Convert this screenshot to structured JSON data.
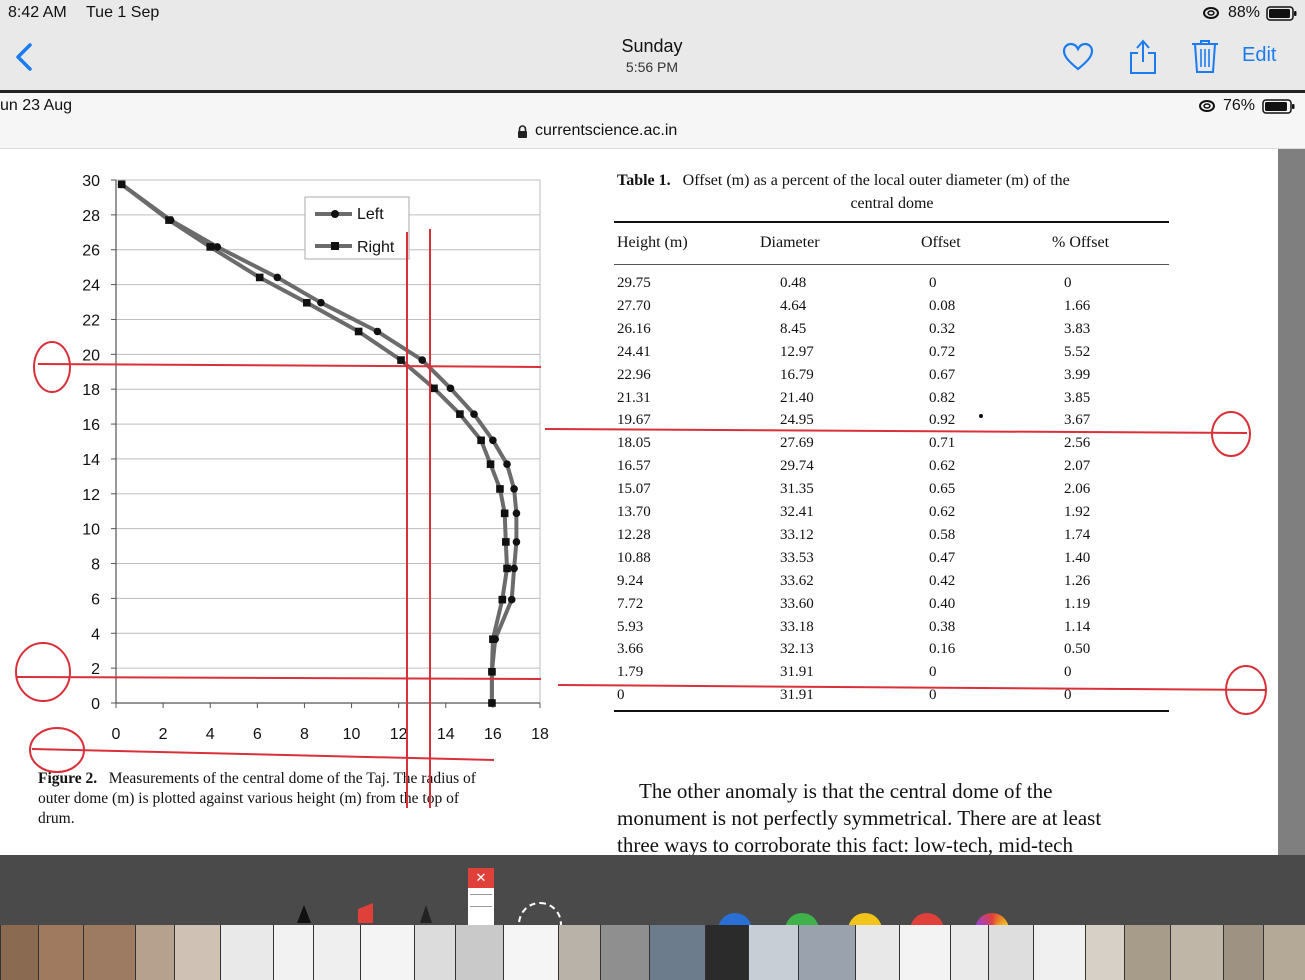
{
  "status": {
    "time": "8:42 AM",
    "date": "Tue 1 Sep",
    "battery": "88%"
  },
  "nav": {
    "title": "Sunday",
    "subtitle": "5:56 PM",
    "edit": "Edit"
  },
  "inner": {
    "date": "un 23 Aug",
    "battery": "76%",
    "url": "currentscience.ac.in"
  },
  "chart_data": {
    "type": "line",
    "xlim": [
      0,
      18
    ],
    "ylim": [
      0,
      30
    ],
    "x_ticks": [
      0,
      2,
      4,
      6,
      8,
      10,
      12,
      14,
      16,
      18
    ],
    "y_ticks": [
      0,
      2,
      4,
      6,
      8,
      10,
      12,
      14,
      16,
      18,
      20,
      22,
      24,
      26,
      28,
      30
    ],
    "grid": true,
    "legend_position": "top-right",
    "series": [
      {
        "name": "Left",
        "marker": "circle",
        "points": [
          [
            0.24,
            29.75
          ],
          [
            2.32,
            27.7
          ],
          [
            4.3,
            26.16
          ],
          [
            6.85,
            24.41
          ],
          [
            8.7,
            22.96
          ],
          [
            11.1,
            21.31
          ],
          [
            13.0,
            19.67
          ],
          [
            14.2,
            18.05
          ],
          [
            15.2,
            16.57
          ],
          [
            16.0,
            15.07
          ],
          [
            16.6,
            13.7
          ],
          [
            16.9,
            12.28
          ],
          [
            17.0,
            10.88
          ],
          [
            17.0,
            9.24
          ],
          [
            16.9,
            7.72
          ],
          [
            16.8,
            5.93
          ],
          [
            16.1,
            3.66
          ],
          [
            15.96,
            1.79
          ],
          [
            15.96,
            0
          ]
        ]
      },
      {
        "name": "Right",
        "marker": "square",
        "points": [
          [
            0.24,
            29.75
          ],
          [
            2.25,
            27.7
          ],
          [
            4.0,
            26.16
          ],
          [
            6.1,
            24.41
          ],
          [
            8.1,
            22.96
          ],
          [
            10.3,
            21.31
          ],
          [
            12.1,
            19.67
          ],
          [
            13.5,
            18.05
          ],
          [
            14.6,
            16.57
          ],
          [
            15.5,
            15.07
          ],
          [
            15.9,
            13.7
          ],
          [
            16.3,
            12.28
          ],
          [
            16.5,
            10.88
          ],
          [
            16.55,
            9.24
          ],
          [
            16.6,
            7.72
          ],
          [
            16.4,
            5.93
          ],
          [
            16.0,
            3.66
          ],
          [
            15.96,
            1.79
          ],
          [
            15.96,
            0
          ]
        ]
      }
    ]
  },
  "figure": {
    "caption_label": "Figure 2.",
    "caption_lines": [
      "Measurements of the central dome of the Taj. The radius of",
      "outer dome (m) is plotted against various height (m) from the top of",
      "drum."
    ]
  },
  "table": {
    "caption_label": "Table 1.",
    "caption_line1": "Offset (m) as a percent of the local outer diameter (m) of the",
    "caption_line2": "central dome",
    "headers": [
      "Height (m)",
      "Diameter",
      "Offset",
      "% Offset"
    ],
    "rows": [
      [
        "29.75",
        "0.48",
        "0",
        "0"
      ],
      [
        "27.70",
        "4.64",
        "0.08",
        "1.66"
      ],
      [
        "26.16",
        "8.45",
        "0.32",
        "3.83"
      ],
      [
        "24.41",
        "12.97",
        "0.72",
        "5.52"
      ],
      [
        "22.96",
        "16.79",
        "0.67",
        "3.99"
      ],
      [
        "21.31",
        "21.40",
        "0.82",
        "3.85"
      ],
      [
        "19.67",
        "24.95",
        "0.92",
        "3.67"
      ],
      [
        "18.05",
        "27.69",
        "0.71",
        "2.56"
      ],
      [
        "16.57",
        "29.74",
        "0.62",
        "2.07"
      ],
      [
        "15.07",
        "31.35",
        "0.65",
        "2.06"
      ],
      [
        "13.70",
        "32.41",
        "0.62",
        "1.92"
      ],
      [
        "12.28",
        "33.12",
        "0.58",
        "1.74"
      ],
      [
        "10.88",
        "33.53",
        "0.47",
        "1.40"
      ],
      [
        "9.24",
        "33.62",
        "0.42",
        "1.26"
      ],
      [
        "7.72",
        "33.60",
        "0.40",
        "1.19"
      ],
      [
        "5.93",
        "33.18",
        "0.38",
        "1.14"
      ],
      [
        "3.66",
        "32.13",
        "0.16",
        "0.50"
      ],
      [
        "1.79",
        "31.91",
        "0",
        "0"
      ],
      [
        "0",
        "31.91",
        "0",
        "0"
      ]
    ]
  },
  "body_text": [
    "The other anomaly is that the central dome of the",
    "monument is not perfectly symmetrical. There are at least",
    "three ways to corroborate this fact: low-tech, mid-tech"
  ],
  "colors": {
    "accent": "#1a7cf0",
    "annotation": "#d9303a",
    "curve": "#6b6b6b"
  }
}
